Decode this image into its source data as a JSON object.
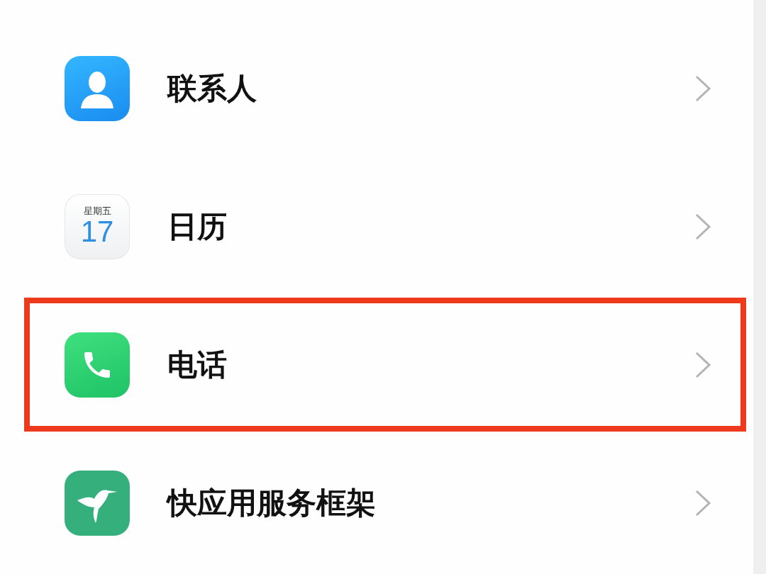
{
  "rows": [
    {
      "kind": "contacts",
      "label": "联系人",
      "highlighted": false
    },
    {
      "kind": "calendar",
      "label": "日历",
      "weekday": "星期五",
      "day": "17",
      "highlighted": false
    },
    {
      "kind": "phone",
      "label": "电话",
      "highlighted": true
    },
    {
      "kind": "quickapp",
      "label": "快应用服务框架",
      "highlighted": false
    }
  ]
}
